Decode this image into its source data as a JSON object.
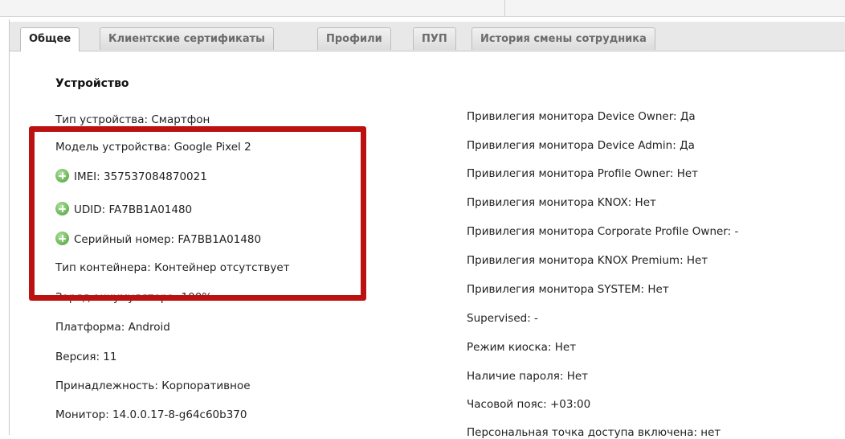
{
  "tabs": [
    {
      "label": "Общее",
      "active": true
    },
    {
      "label": "Клиентские сертификаты",
      "active": false
    },
    {
      "label": "Профили",
      "active": false
    },
    {
      "label": "ПУП",
      "active": false
    },
    {
      "label": "История смены сотрудника",
      "active": false
    }
  ],
  "section_title": "Устройство",
  "left_fields": [
    "Тип устройства: Смартфон",
    "Модель устройства: Google Pixel 2",
    "IMEI: 357537084870021",
    "UDID: FA7BB1A01480",
    "Серийный номер: FA7BB1A01480",
    "Тип контейнера: Контейнер отсутствует",
    "Заряд аккумулятора: 100%",
    "Платформа: Android",
    "Версия: 11",
    "Принадлежность: Корпоративное",
    "Монитор: 14.0.0.17-8-g64c60b370"
  ],
  "right_fields": [
    "Привилегия монитора Device Owner: Да",
    "Привилегия монитора Device Admin: Да",
    "Привилегия монитора Profile Owner: Нет",
    "Привилегия монитора KNOX: Нет",
    "Привилегия монитора Corporate Profile Owner: -",
    "Привилегия монитора KNOX Premium: Нет",
    "Привилегия монитора SYSTEM: Нет",
    "Supervised: -",
    "Режим киоска: Нет",
    "Наличие пароля: Нет",
    "Часовой пояс: +03:00",
    "Персональная точка доступа включена: нет"
  ],
  "colors": {
    "highlight": "#bb1111",
    "plus_icon": "#6fb95a"
  },
  "icons": {
    "expand": "plus-circle-icon"
  }
}
